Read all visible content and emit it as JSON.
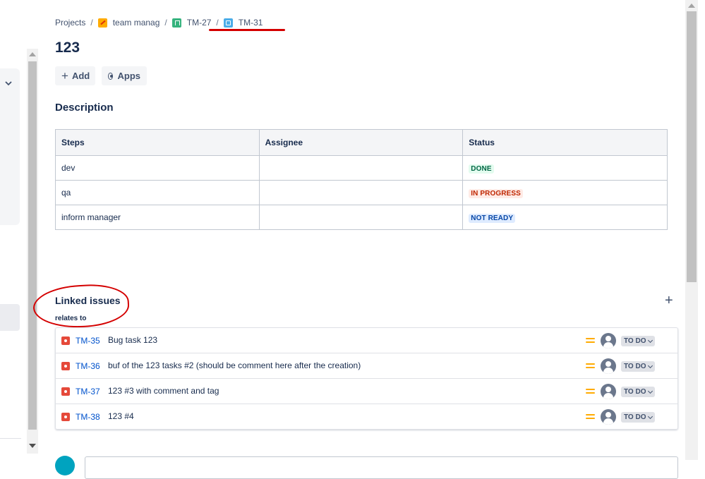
{
  "breadcrumb": {
    "projects": "Projects",
    "project": "team manag",
    "parent": "TM-27",
    "current": "TM-31",
    "separator": "/"
  },
  "issue": {
    "title": "123"
  },
  "toolbar": {
    "add_label": "Add",
    "apps_label": "Apps"
  },
  "description": {
    "heading": "Description",
    "columns": [
      "Steps",
      "Assignee",
      "Status"
    ],
    "rows": [
      {
        "step": "dev",
        "assignee": "",
        "status": "DONE"
      },
      {
        "step": "qa",
        "assignee": "",
        "status": "IN PROGRESS"
      },
      {
        "step": "inform manager",
        "assignee": "",
        "status": "NOT READY"
      }
    ]
  },
  "linked": {
    "heading": "Linked issues",
    "relation": "relates to",
    "items": [
      {
        "key": "TM-35",
        "summary": "Bug task 123",
        "status": "TO DO"
      },
      {
        "key": "TM-36",
        "summary": "buf of the 123 tasks #2 (should be comment here after the creation)",
        "status": "TO DO"
      },
      {
        "key": "TM-37",
        "summary": "123 #3 with comment and tag",
        "status": "TO DO"
      },
      {
        "key": "TM-38",
        "summary": "123 #4",
        "status": "TO DO"
      }
    ]
  },
  "colors": {
    "annotation": "#d40000",
    "link": "#0052cc",
    "bug": "#e5493a",
    "priority_medium": "#ffab00"
  },
  "icons": {
    "project": "team-project-icon",
    "parent": "story-icon",
    "current": "subtask-icon",
    "issue_type": "bug-icon",
    "priority": "priority-medium-icon"
  }
}
